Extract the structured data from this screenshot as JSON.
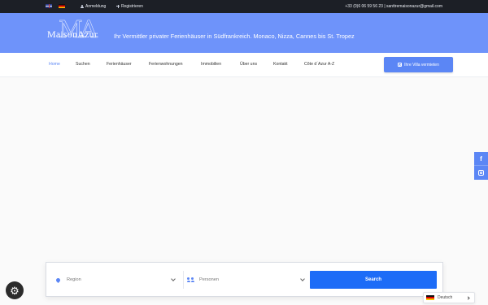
{
  "topbar": {
    "languages": [
      "en",
      "de"
    ],
    "login_label": "Anmeldung",
    "register_label": "Registrieren",
    "contact_text": "+33 (0)6 06 59 56 23 | santtremaisonazur@gmail.com"
  },
  "header": {
    "logo_text": "MaisonAzur",
    "logo_mark": "MA",
    "tagline": "Ihr Vermittler privater Ferienhäuser in Südfrankreich. Monaco, Nizza, Cannes bis St. Tropez"
  },
  "nav": {
    "items": [
      {
        "label": "Home",
        "active": true
      },
      {
        "label": "Suchen"
      },
      {
        "label": "Ferienhäuser"
      },
      {
        "label": "Ferienwohnungen"
      },
      {
        "label": "Immobilien"
      },
      {
        "label": "Über uns"
      },
      {
        "label": "Kontakt"
      },
      {
        "label": "Côte d´Azur A-Z"
      }
    ],
    "cta_label": "Ihre Villa vermieten"
  },
  "search": {
    "region_placeholder": "Region",
    "persons_placeholder": "Personen",
    "button_label": "Search"
  },
  "social": {
    "facebook_glyph": "f"
  },
  "language_switcher": {
    "current": "Deutsch"
  },
  "colors": {
    "accent": "#5b86f5",
    "banner": "#6e93fa",
    "topbar": "#1c1f26",
    "search_button": "#1d6cf7"
  },
  "icons": [
    "user-icon",
    "plus-icon",
    "checkbox-icon",
    "facebook-icon",
    "instagram-icon",
    "map-pin-icon",
    "people-icon",
    "chevron-down-icon",
    "gear-icon",
    "german-flag-icon"
  ]
}
